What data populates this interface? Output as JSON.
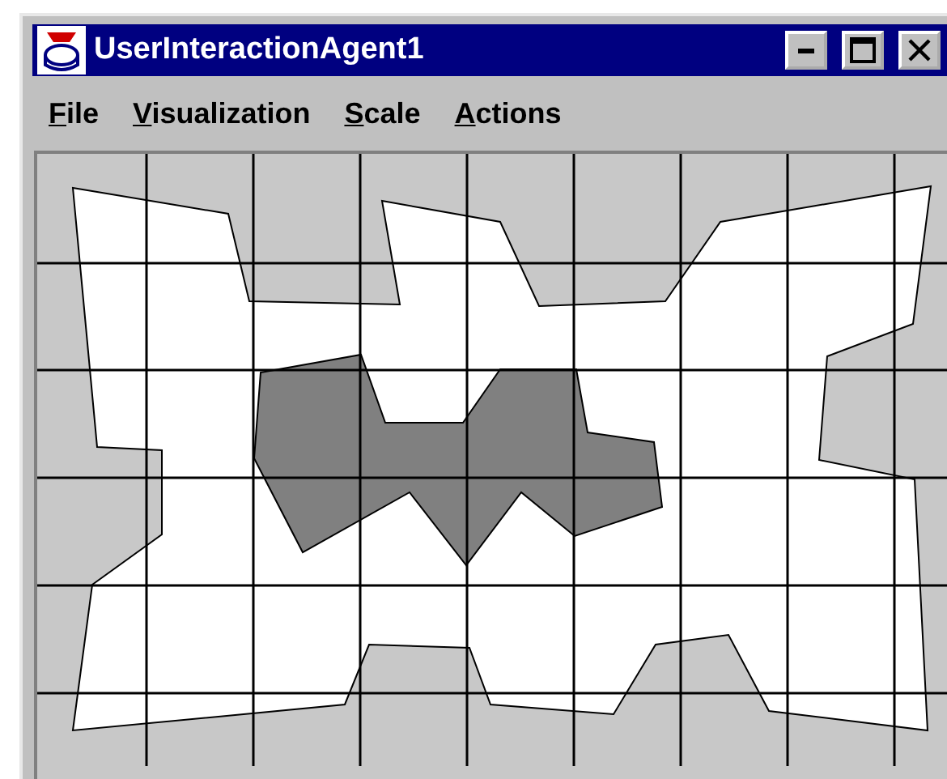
{
  "window": {
    "title": "UserInteractionAgent1"
  },
  "menus": [
    {
      "label": "File"
    },
    {
      "label": "Visualization"
    },
    {
      "label": "Scale"
    },
    {
      "label": "Actions"
    }
  ]
}
